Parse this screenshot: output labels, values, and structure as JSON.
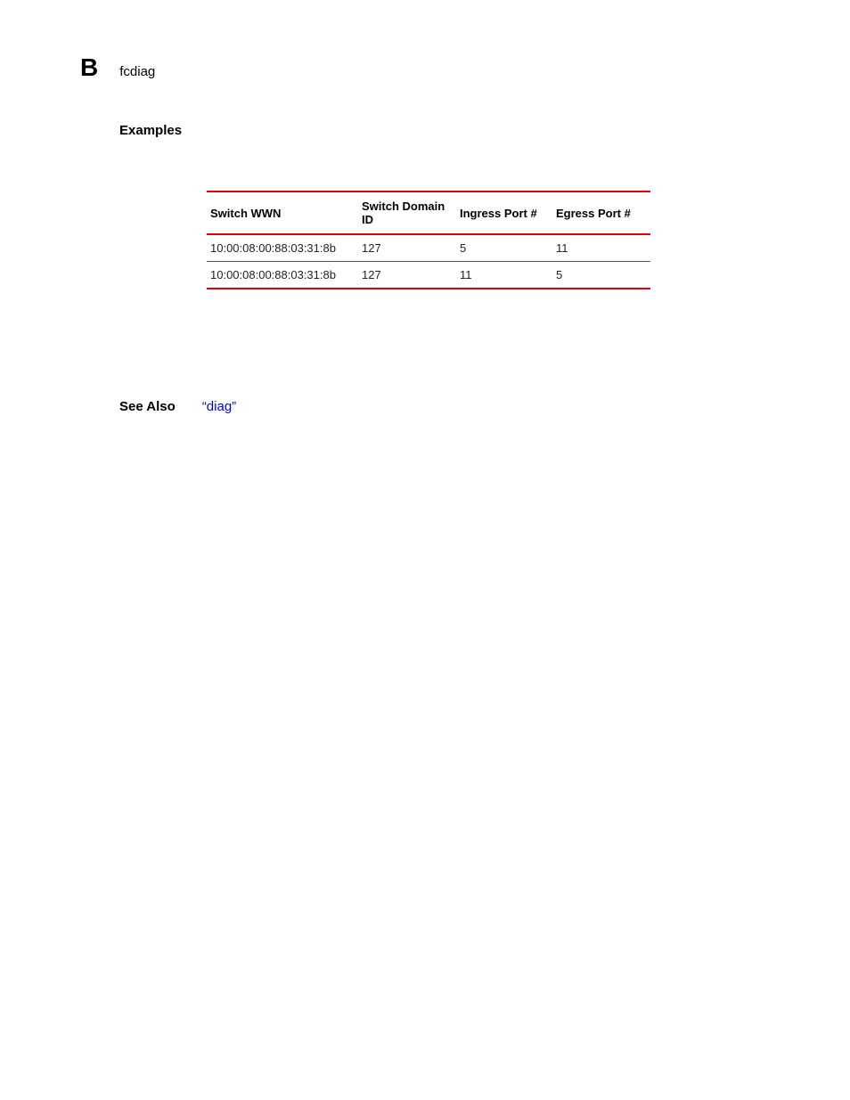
{
  "header": {
    "section_letter": "B",
    "section_name": "fcdiag"
  },
  "examples_heading": "Examples",
  "table": {
    "headers": {
      "wwn": "Switch WWN",
      "domain": "Switch Domain ID",
      "ingress": "Ingress Port #",
      "egress": "Egress Port #"
    },
    "rows": [
      {
        "wwn": "10:00:08:00:88:03:31:8b",
        "domain": "127",
        "ingress": "5",
        "egress": "11"
      },
      {
        "wwn": "10:00:08:00:88:03:31:8b",
        "domain": "127",
        "ingress": "11",
        "egress": "5"
      }
    ]
  },
  "see_also": {
    "label": "See Also",
    "link_text": "“diag”"
  }
}
